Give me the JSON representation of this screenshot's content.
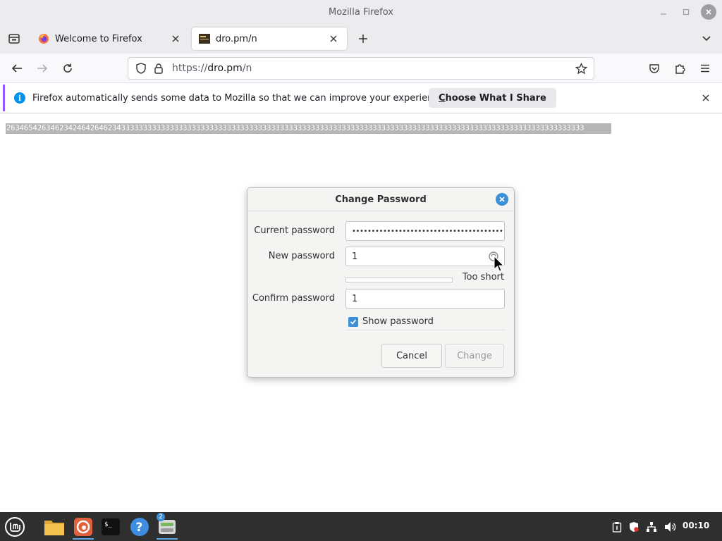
{
  "window": {
    "title": "Mozilla Firefox"
  },
  "tabs": [
    {
      "label": "Welcome to Firefox",
      "active": false
    },
    {
      "label": "dro.pm/n",
      "active": true
    }
  ],
  "navbar": {
    "url_scheme": "https://",
    "url_host": "dro.pm",
    "url_path": "/n"
  },
  "notification": {
    "text": "Firefox automatically sends some data to Mozilla so that we can improve your experience.",
    "button_label_first": "C",
    "button_label_rest": "hoose What I Share"
  },
  "page": {
    "selected_text": "26346542634623424642646234333333333333333333333333333333333333333333333333333333333333333333333333333333333333333333333333333333333"
  },
  "dialog": {
    "title": "Change Password",
    "current_password_label": "Current password",
    "current_password_value": "••••••••••••••••••••••••••••••••••••••••••••",
    "new_password_label": "New password",
    "new_password_value": "1",
    "strength_text": "Too short",
    "strength_level": 0,
    "confirm_password_label": "Confirm password",
    "confirm_password_value": "1",
    "show_password_label": "Show password",
    "show_password_checked": true,
    "cancel_label": "Cancel",
    "change_label": "Change"
  },
  "taskbar": {
    "workspace_badge": "2",
    "clock": "00:10"
  },
  "colors": {
    "accent_blue": "#3a8fd5",
    "firefox_info": "#0090ed",
    "notification_stripe": "#9059ff",
    "taskbar_bg": "#2f2f2f"
  }
}
